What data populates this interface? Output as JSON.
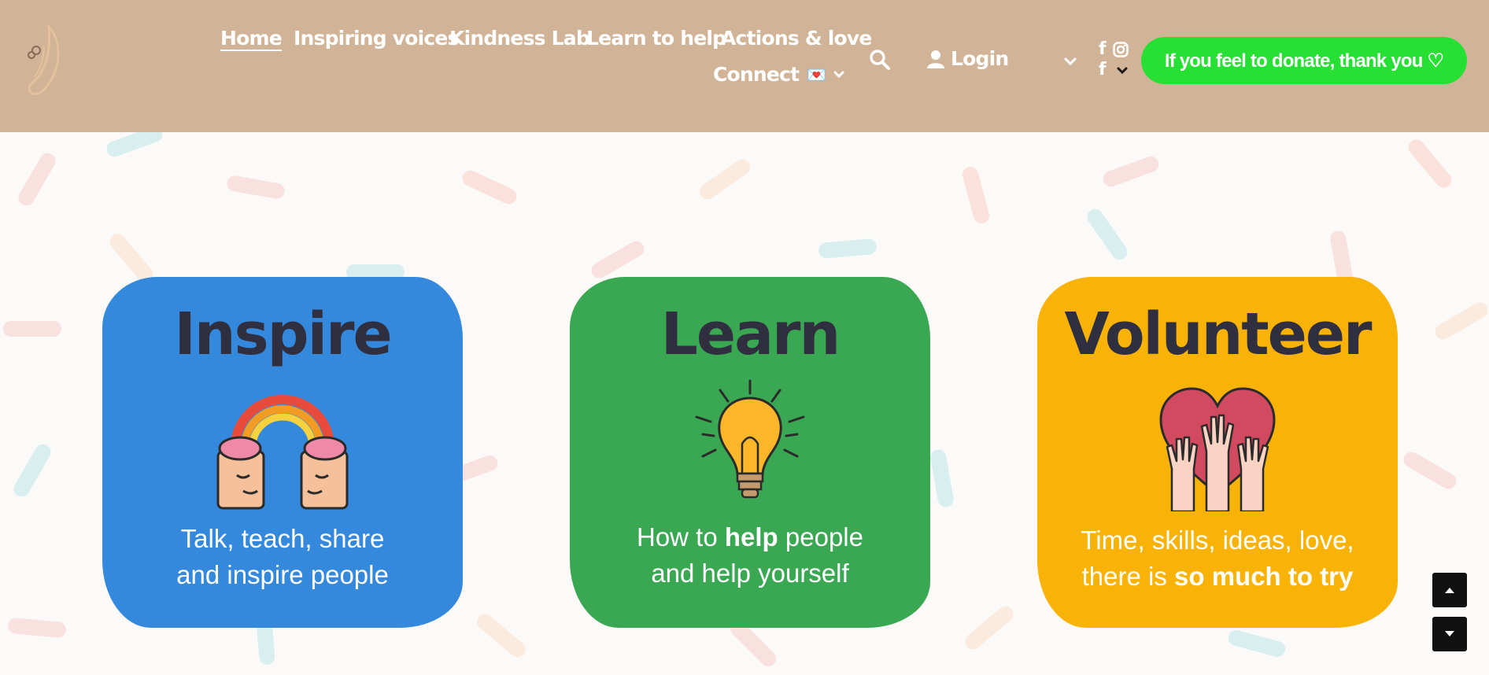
{
  "nav": {
    "items": [
      {
        "label": "Home",
        "active": true
      },
      {
        "label": "Inspiring voices"
      },
      {
        "label": "Kindness Lab"
      },
      {
        "label": "Learn to help"
      },
      {
        "label": "Actions & love"
      }
    ],
    "connect_label": "Connect",
    "connect_emoji": "💌",
    "login_label": "Login",
    "donate_label": "If you feel to donate, thank you ♡",
    "facebook_label": "f",
    "icons": [
      "logo-icon",
      "search-icon",
      "user-icon",
      "chevron-down-icon",
      "facebook-icon",
      "instagram-icon"
    ]
  },
  "cards": [
    {
      "title": "Inspire",
      "text_line1": "Talk, teach, share",
      "text_line2": "and inspire people",
      "color": "#3589dc",
      "icon": "rainbow-heads-icon"
    },
    {
      "title": "Learn",
      "text_line1_before": "How to ",
      "text_line1_bold": "help",
      "text_line1_after": " people",
      "text_line2": "and help yourself",
      "color": "#3aa852",
      "icon": "light-bulb-icon"
    },
    {
      "title": "Volunteer",
      "text_line1": "Time, skills, ideas, love,",
      "text_line2_before": "there is ",
      "text_line2_bold": "so much to try",
      "color": "#f9b306",
      "icon": "heart-hands-icon"
    }
  ],
  "colors": {
    "header_bg": "#d1b397",
    "donate_bg": "#27e034",
    "page_bg": "#fcfaf8",
    "title_text": "#2f2f40"
  },
  "scroll": {
    "up_icon": "arrow-up-icon",
    "down_icon": "arrow-down-icon"
  }
}
